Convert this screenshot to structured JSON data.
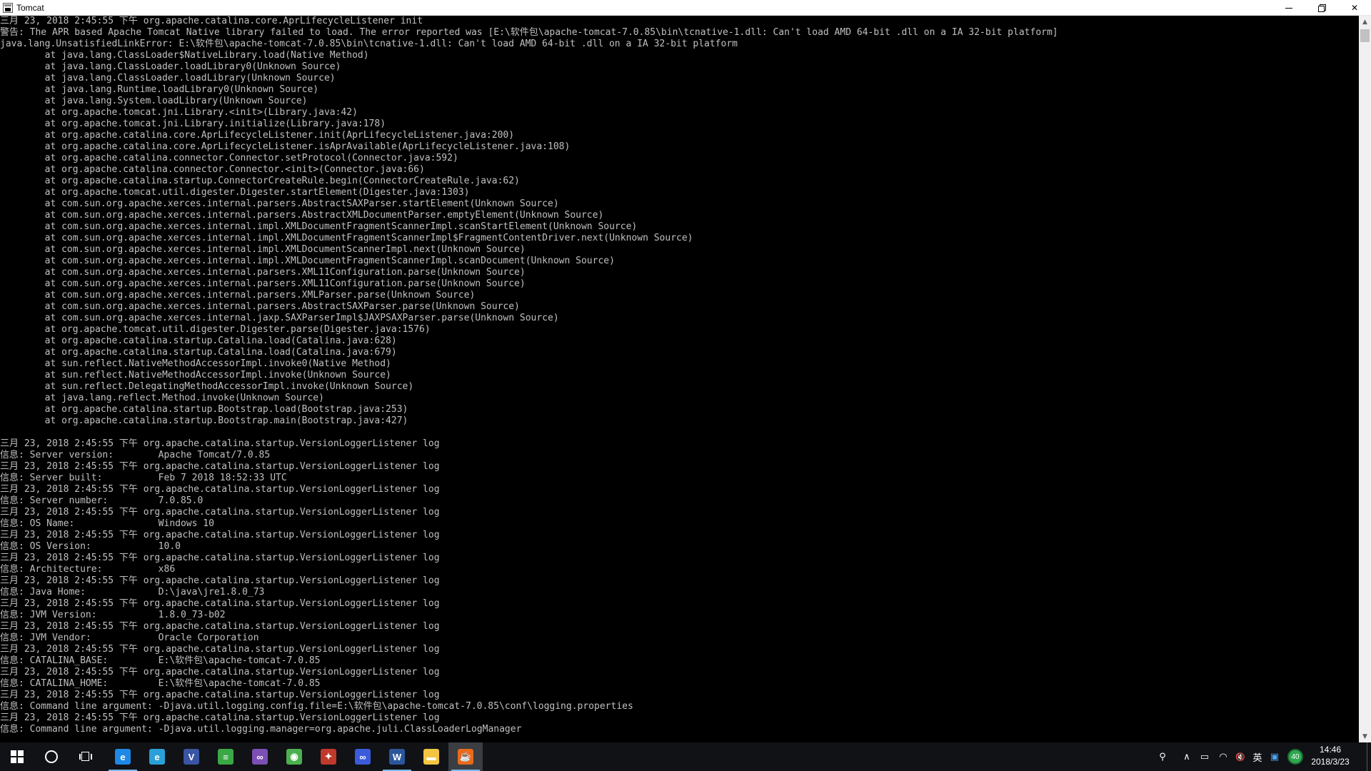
{
  "window": {
    "title": "Tomcat",
    "minimize_glyph": "",
    "close_glyph": "✕"
  },
  "console": {
    "text_color": "#c0c0c0",
    "background": "#000000",
    "lines": [
      "三月 23, 2018 2:45:55 下午 org.apache.catalina.core.AprLifecycleListener init",
      "警告: The APR based Apache Tomcat Native library failed to load. The error reported was [E:\\软件包\\apache-tomcat-7.0.85\\bin\\tcnative-1.dll: Can't load AMD 64-bit .dll on a IA 32-bit platform]",
      "java.lang.UnsatisfiedLinkError: E:\\软件包\\apache-tomcat-7.0.85\\bin\\tcnative-1.dll: Can't load AMD 64-bit .dll on a IA 32-bit platform",
      "        at java.lang.ClassLoader$NativeLibrary.load(Native Method)",
      "        at java.lang.ClassLoader.loadLibrary0(Unknown Source)",
      "        at java.lang.ClassLoader.loadLibrary(Unknown Source)",
      "        at java.lang.Runtime.loadLibrary0(Unknown Source)",
      "        at java.lang.System.loadLibrary(Unknown Source)",
      "        at org.apache.tomcat.jni.Library.<init>(Library.java:42)",
      "        at org.apache.tomcat.jni.Library.initialize(Library.java:178)",
      "        at org.apache.catalina.core.AprLifecycleListener.init(AprLifecycleListener.java:200)",
      "        at org.apache.catalina.core.AprLifecycleListener.isAprAvailable(AprLifecycleListener.java:108)",
      "        at org.apache.catalina.connector.Connector.setProtocol(Connector.java:592)",
      "        at org.apache.catalina.connector.Connector.<init>(Connector.java:66)",
      "        at org.apache.catalina.startup.ConnectorCreateRule.begin(ConnectorCreateRule.java:62)",
      "        at org.apache.tomcat.util.digester.Digester.startElement(Digester.java:1303)",
      "        at com.sun.org.apache.xerces.internal.parsers.AbstractSAXParser.startElement(Unknown Source)",
      "        at com.sun.org.apache.xerces.internal.parsers.AbstractXMLDocumentParser.emptyElement(Unknown Source)",
      "        at com.sun.org.apache.xerces.internal.impl.XMLDocumentFragmentScannerImpl.scanStartElement(Unknown Source)",
      "        at com.sun.org.apache.xerces.internal.impl.XMLDocumentFragmentScannerImpl$FragmentContentDriver.next(Unknown Source)",
      "        at com.sun.org.apache.xerces.internal.impl.XMLDocumentScannerImpl.next(Unknown Source)",
      "        at com.sun.org.apache.xerces.internal.impl.XMLDocumentFragmentScannerImpl.scanDocument(Unknown Source)",
      "        at com.sun.org.apache.xerces.internal.parsers.XML11Configuration.parse(Unknown Source)",
      "        at com.sun.org.apache.xerces.internal.parsers.XML11Configuration.parse(Unknown Source)",
      "        at com.sun.org.apache.xerces.internal.parsers.XMLParser.parse(Unknown Source)",
      "        at com.sun.org.apache.xerces.internal.parsers.AbstractSAXParser.parse(Unknown Source)",
      "        at com.sun.org.apache.xerces.internal.jaxp.SAXParserImpl$JAXPSAXParser.parse(Unknown Source)",
      "        at org.apache.tomcat.util.digester.Digester.parse(Digester.java:1576)",
      "        at org.apache.catalina.startup.Catalina.load(Catalina.java:628)",
      "        at org.apache.catalina.startup.Catalina.load(Catalina.java:679)",
      "        at sun.reflect.NativeMethodAccessorImpl.invoke0(Native Method)",
      "        at sun.reflect.NativeMethodAccessorImpl.invoke(Unknown Source)",
      "        at sun.reflect.DelegatingMethodAccessorImpl.invoke(Unknown Source)",
      "        at java.lang.reflect.Method.invoke(Unknown Source)",
      "        at org.apache.catalina.startup.Bootstrap.load(Bootstrap.java:253)",
      "        at org.apache.catalina.startup.Bootstrap.main(Bootstrap.java:427)",
      "",
      "三月 23, 2018 2:45:55 下午 org.apache.catalina.startup.VersionLoggerListener log",
      "信息: Server version:        Apache Tomcat/7.0.85",
      "三月 23, 2018 2:45:55 下午 org.apache.catalina.startup.VersionLoggerListener log",
      "信息: Server built:          Feb 7 2018 18:52:33 UTC",
      "三月 23, 2018 2:45:55 下午 org.apache.catalina.startup.VersionLoggerListener log",
      "信息: Server number:         7.0.85.0",
      "三月 23, 2018 2:45:55 下午 org.apache.catalina.startup.VersionLoggerListener log",
      "信息: OS Name:               Windows 10",
      "三月 23, 2018 2:45:55 下午 org.apache.catalina.startup.VersionLoggerListener log",
      "信息: OS Version:            10.0",
      "三月 23, 2018 2:45:55 下午 org.apache.catalina.startup.VersionLoggerListener log",
      "信息: Architecture:          x86",
      "三月 23, 2018 2:45:55 下午 org.apache.catalina.startup.VersionLoggerListener log",
      "信息: Java Home:             D:\\java\\jre1.8.0_73",
      "三月 23, 2018 2:45:55 下午 org.apache.catalina.startup.VersionLoggerListener log",
      "信息: JVM Version:           1.8.0_73-b02",
      "三月 23, 2018 2:45:55 下午 org.apache.catalina.startup.VersionLoggerListener log",
      "信息: JVM Vendor:            Oracle Corporation",
      "三月 23, 2018 2:45:55 下午 org.apache.catalina.startup.VersionLoggerListener log",
      "信息: CATALINA_BASE:         E:\\软件包\\apache-tomcat-7.0.85",
      "三月 23, 2018 2:45:55 下午 org.apache.catalina.startup.VersionLoggerListener log",
      "信息: CATALINA_HOME:         E:\\软件包\\apache-tomcat-7.0.85",
      "三月 23, 2018 2:45:55 下午 org.apache.catalina.startup.VersionLoggerListener log",
      "信息: Command line argument: -Djava.util.logging.config.file=E:\\软件包\\apache-tomcat-7.0.85\\conf\\logging.properties",
      "三月 23, 2018 2:45:55 下午 org.apache.catalina.startup.VersionLoggerListener log",
      "信息: Command line argument: -Djava.util.logging.manager=org.apache.juli.ClassLoaderLogManager"
    ]
  },
  "taskbar": {
    "apps": [
      {
        "name": "edge-icon",
        "glyph": "e",
        "color": "#1e88e5",
        "running": true
      },
      {
        "name": "browser-icon",
        "glyph": "e",
        "color": "#2a9fd8",
        "running": false
      },
      {
        "name": "visio-icon",
        "glyph": "V",
        "color": "#3955a3",
        "running": false
      },
      {
        "name": "green-app-icon",
        "glyph": "≡",
        "color": "#3aa845",
        "running": false
      },
      {
        "name": "visual-studio-icon",
        "glyph": "∞",
        "color": "#7b4fb3",
        "running": false
      },
      {
        "name": "android-icon",
        "glyph": "◉",
        "color": "#4caf50",
        "running": false
      },
      {
        "name": "paint-app-icon",
        "glyph": "✦",
        "color": "#c0392b",
        "running": false
      },
      {
        "name": "infinity-app-icon",
        "glyph": "∞",
        "color": "#3b5bdb",
        "running": false
      },
      {
        "name": "word-icon",
        "glyph": "W",
        "color": "#2b579a",
        "running": true
      },
      {
        "name": "file-explorer-icon",
        "glyph": "▬",
        "color": "#f4c542",
        "running": false
      },
      {
        "name": "java-icon",
        "glyph": "☕",
        "color": "#e86a1c",
        "running": true
      }
    ],
    "tray": {
      "people_glyph": "⚲",
      "chevron_glyph": "∧",
      "battery_glyph": "▭",
      "wifi_glyph": "◠",
      "volume_glyph": "🔇",
      "ime_label": "英",
      "message_glyph": "▣",
      "badge_count": "40"
    },
    "clock": {
      "time": "14:46",
      "date": "2018/3/23"
    }
  }
}
